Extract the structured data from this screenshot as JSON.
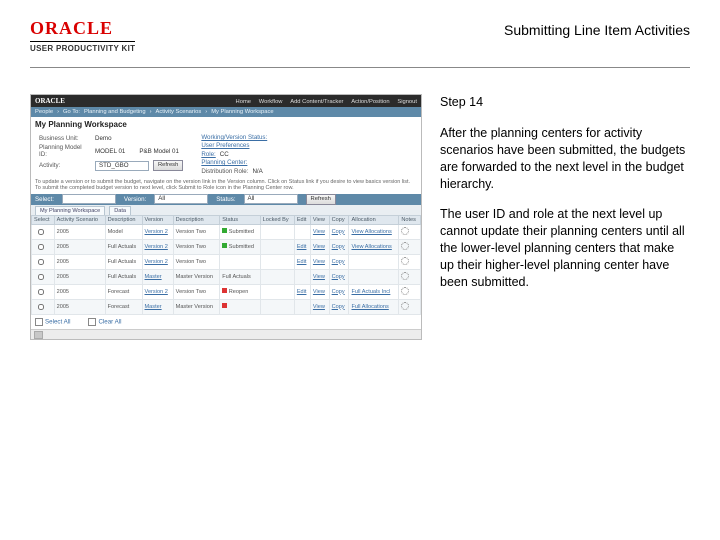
{
  "header": {
    "brand": "ORACLE",
    "product_line": "USER PRODUCTIVITY KIT",
    "lesson_title": "Submitting Line Item Activities"
  },
  "instruction": {
    "step_label": "Step 14",
    "para1": "After the planning centers for activity scenarios have been submitted, the budgets are forwarded to the next level in the budget hierarchy.",
    "para2": "The user ID and role at the next level up cannot update their planning centers until all the lower-level planning centers that make up their higher-level planning center have been submitted."
  },
  "screenshot": {
    "topbar": {
      "brand": "ORACLE",
      "links": [
        "Home",
        "Workflow",
        "Add Content/Tracker",
        "Action/Position",
        "Signout"
      ]
    },
    "breadcrumb": [
      "People",
      "Go To:",
      "Planning and Budgeting",
      "Activity Scenarios",
      "My Planning Workspace"
    ],
    "workspace_title": "My Planning Workspace",
    "left_form": {
      "business_unit_k": "Business Unit:",
      "business_unit_v": "Demo",
      "planning_model_k": "Planning Model ID:",
      "planning_model_v": "MODEL 01",
      "pnb_model_id_k": "",
      "pnb_model_id_v": "P&B Model 01",
      "activity_k": "Activity:",
      "activity_v": "STD_GBO",
      "refresh_btn": "Refresh"
    },
    "right_form": {
      "working_k": "Working/Version Status:",
      "working_v": "",
      "user_pref_k": "User Preferences",
      "user_pref_v": "",
      "role_k": "Role:",
      "role_v": "CC",
      "planning_center_k": "Planning Center:",
      "planning_center_v": "",
      "dist_k": "Distribution Role:",
      "dist_v": "N/A"
    },
    "hint": "To update a version or to submit the budget, navigate on the version link in the Version column. Click on Status link if you desire to view basics version list. To submit the completed budget version to next level, click Submit to Role icon in the Planning Center row.",
    "band": {
      "select_k": "Select:",
      "select_v": "",
      "version_k": "Version:",
      "version_v": "All",
      "status_k": "Status:",
      "status_v": "All",
      "refresh_btn": "Refresh"
    },
    "tabs": [
      "My Planning Workspace",
      "Data"
    ],
    "cols": [
      "Select",
      "Activity Scenario",
      "Description",
      "Version",
      "Description",
      "Status",
      "Locked By",
      "Edit",
      "View",
      "Copy",
      "Allocation",
      "Notes"
    ],
    "rows": [
      {
        "scen": "2005",
        "desc": "Model",
        "ver": "Version 2",
        "vdesc": "Version Two",
        "status": "Submitted",
        "lock": "",
        "edit": "",
        "view": "View",
        "copy": "Copy",
        "alloc": "View Allocations",
        "flag": "g"
      },
      {
        "scen": "2005",
        "desc": "Full Actuals",
        "ver": "Version 2",
        "vdesc": "Version Two",
        "status": "Submitted",
        "lock": "",
        "edit": "Edit",
        "view": "View",
        "copy": "Copy",
        "alloc": "View Allocations",
        "flag": "g"
      },
      {
        "scen": "2005",
        "desc": "Full Actuals",
        "ver": "Version 2",
        "vdesc": "Version Two",
        "status": "",
        "lock": "",
        "edit": "Edit",
        "view": "View",
        "copy": "Copy",
        "alloc": "",
        "flag": ""
      },
      {
        "scen": "2005",
        "desc": "Full Actuals",
        "ver": "Master",
        "vdesc": "Master Version",
        "status": "Full Actuals",
        "lock": "",
        "edit": "",
        "view": "View",
        "copy": "Copy",
        "alloc": "",
        "flag": ""
      },
      {
        "scen": "2005",
        "desc": "Forecast",
        "ver": "Version 2",
        "vdesc": "Version Two",
        "status": "Reopen",
        "lock": "",
        "edit": "Edit",
        "view": "View",
        "copy": "Copy",
        "alloc": "Full Actuals Incl",
        "flag": "r"
      },
      {
        "scen": "2005",
        "desc": "Forecast",
        "ver": "Master",
        "vdesc": "Master Version",
        "status": "",
        "lock": "",
        "edit": "",
        "view": "View",
        "copy": "Copy",
        "alloc": "Full Allocations",
        "flag": "r"
      }
    ],
    "footer_links": {
      "select_all": "Select All",
      "clear_all": "Clear All"
    }
  }
}
